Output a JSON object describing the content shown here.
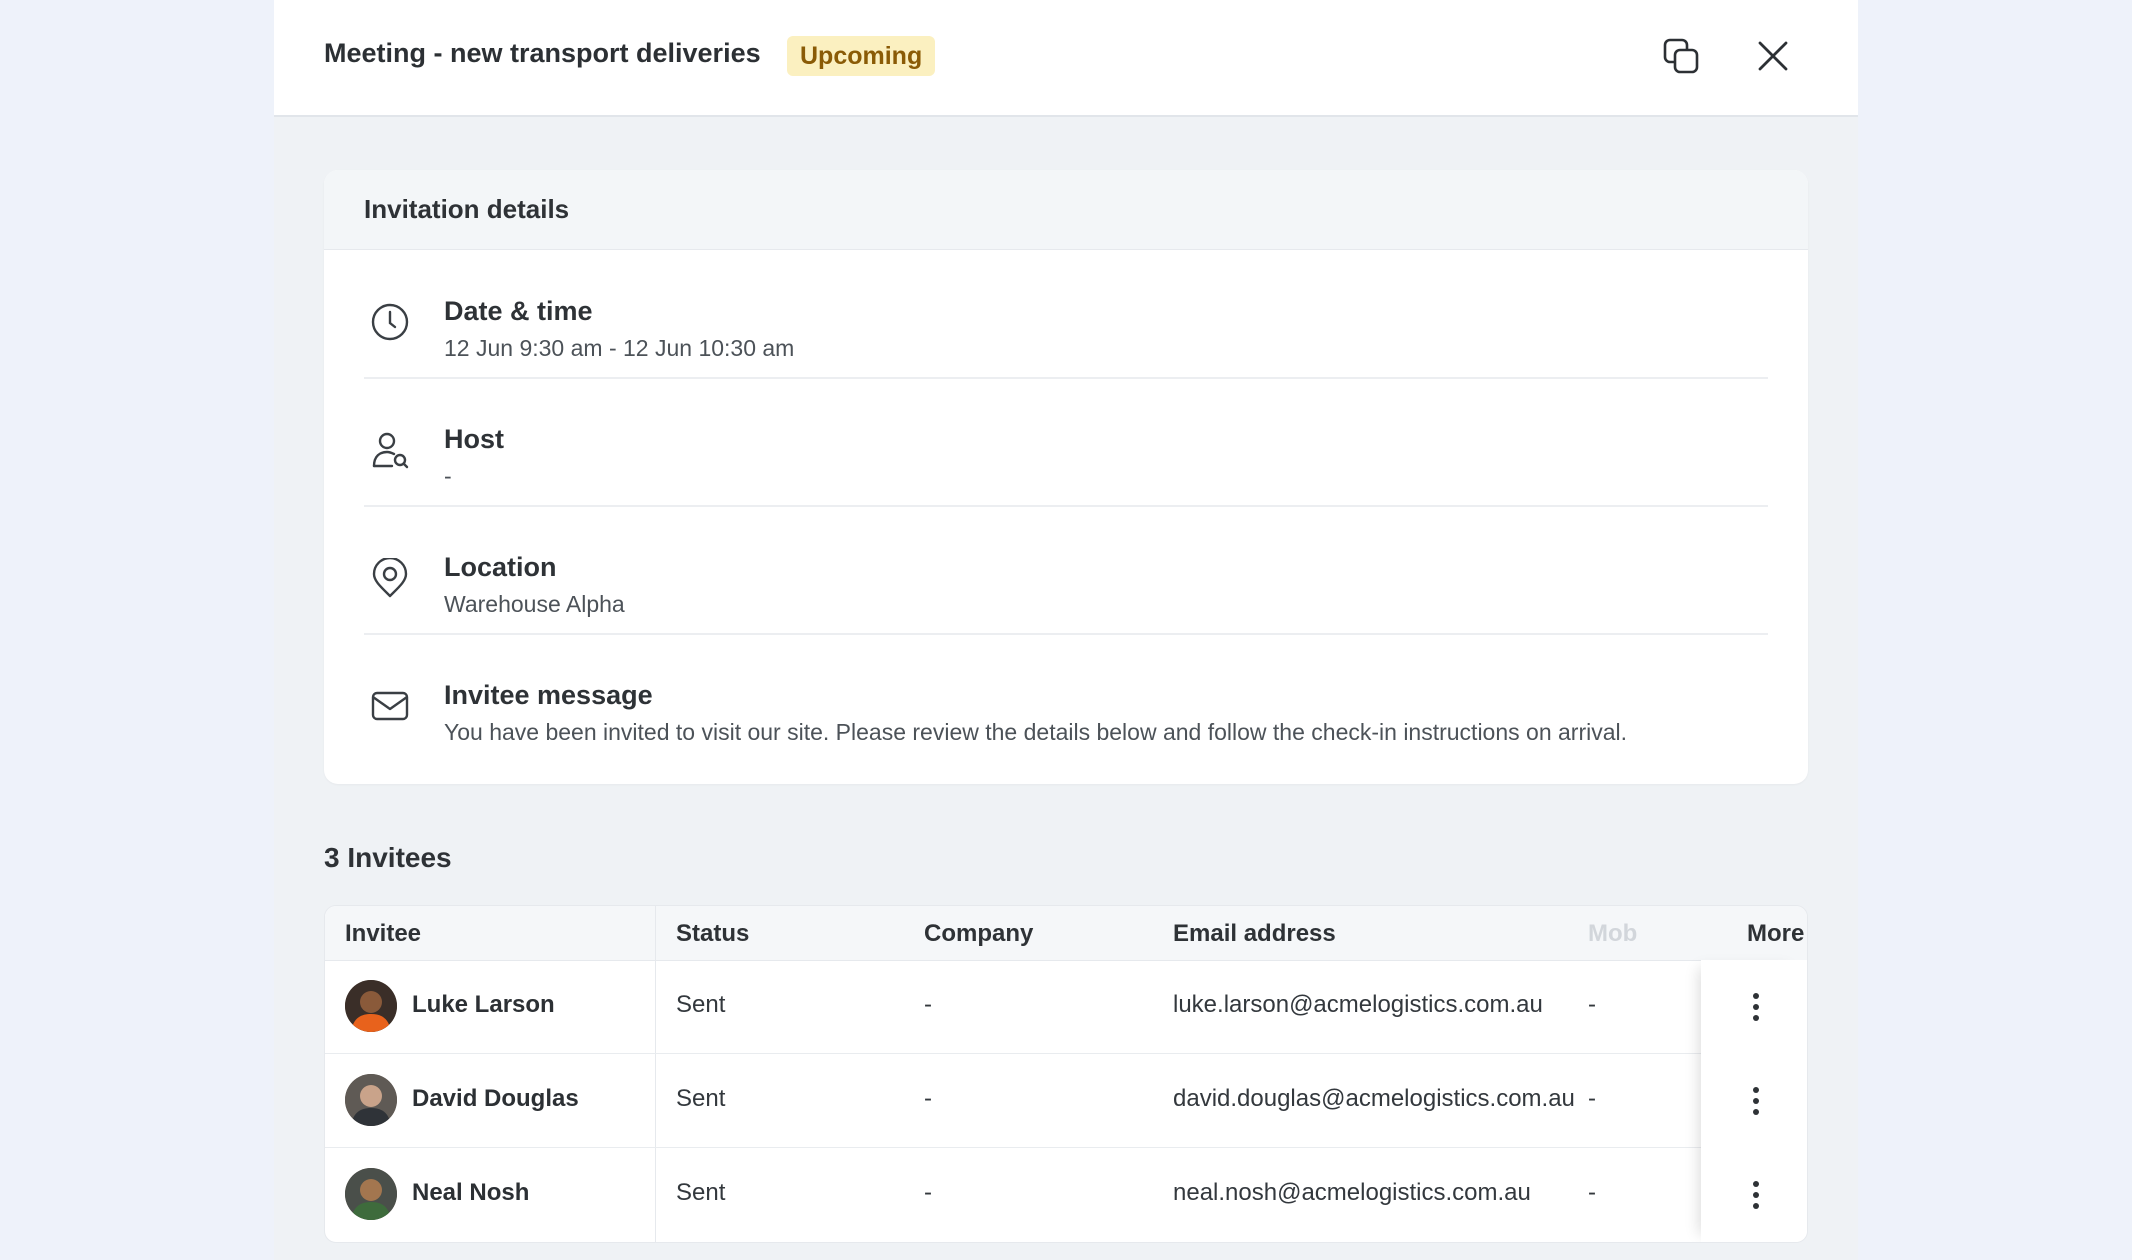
{
  "header": {
    "title": "Meeting - new transport deliveries",
    "status_badge": "Upcoming"
  },
  "details": {
    "title": "Invitation details",
    "rows": [
      {
        "icon": "clock-icon",
        "label": "Date & time",
        "value": "12 Jun 9:30 am - 12 Jun 10:30 am"
      },
      {
        "icon": "host-icon",
        "label": "Host",
        "value": "-"
      },
      {
        "icon": "location-pin-icon",
        "label": "Location",
        "value": "Warehouse Alpha"
      },
      {
        "icon": "envelope-icon",
        "label": "Invitee message",
        "value": "You have been invited to visit our site. Please review the details below and follow the check-in instructions on arrival."
      }
    ]
  },
  "invitees": {
    "title": "3 Invitees",
    "columns": [
      "Invitee",
      "Status",
      "Company",
      "Email address",
      "Mob"
    ],
    "more_label": "More",
    "rows": [
      {
        "name": "Luke Larson",
        "status": "Sent",
        "company": "-",
        "email": "luke.larson@acmelogistics.com.au",
        "mobile": "-"
      },
      {
        "name": "David Douglas",
        "status": "Sent",
        "company": "-",
        "email": "david.douglas@acmelogistics.com.au",
        "mobile": "-"
      },
      {
        "name": "Neal Nosh",
        "status": "Sent",
        "company": "-",
        "email": "neal.nosh@acmelogistics.com.au",
        "mobile": "-"
      }
    ]
  },
  "colors": {
    "badge_bg": "#fbf0c0",
    "badge_text": "#8a5b06",
    "page_bg": "#eef2fa",
    "panel_bg": "#eff2f5"
  }
}
